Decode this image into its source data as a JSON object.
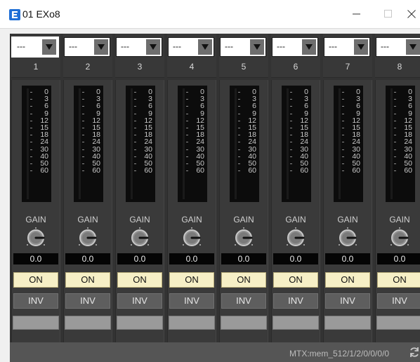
{
  "window": {
    "title": "01 EXo8",
    "minimize_glyph": "minimize-icon",
    "maximize_glyph": "maximize-icon",
    "close_glyph": "close-icon"
  },
  "channels": [
    {
      "select_value": "---",
      "number": "1",
      "gain_label": "GAIN",
      "gain_value": "0.0",
      "on_label": "ON",
      "inv_label": "INV"
    },
    {
      "select_value": "---",
      "number": "2",
      "gain_label": "GAIN",
      "gain_value": "0.0",
      "on_label": "ON",
      "inv_label": "INV"
    },
    {
      "select_value": "---",
      "number": "3",
      "gain_label": "GAIN",
      "gain_value": "0.0",
      "on_label": "ON",
      "inv_label": "INV"
    },
    {
      "select_value": "---",
      "number": "4",
      "gain_label": "GAIN",
      "gain_value": "0.0",
      "on_label": "ON",
      "inv_label": "INV"
    },
    {
      "select_value": "---",
      "number": "5",
      "gain_label": "GAIN",
      "gain_value": "0.0",
      "on_label": "ON",
      "inv_label": "INV"
    },
    {
      "select_value": "---",
      "number": "6",
      "gain_label": "GAIN",
      "gain_value": "0.0",
      "on_label": "ON",
      "inv_label": "INV"
    },
    {
      "select_value": "---",
      "number": "7",
      "gain_label": "GAIN",
      "gain_value": "0.0",
      "on_label": "ON",
      "inv_label": "INV"
    },
    {
      "select_value": "---",
      "number": "8",
      "gain_label": "GAIN",
      "gain_value": "0.0",
      "on_label": "ON",
      "inv_label": "INV"
    }
  ],
  "meter_scale": [
    "0",
    "3",
    "6",
    "9",
    "12",
    "15",
    "18",
    "24",
    "30",
    "40",
    "50",
    "60"
  ],
  "status": {
    "text": "MTX:mem_512/1/2/0/0/0/0"
  },
  "colors": {
    "accent": "#1f6fd6",
    "on_button": "#f6efc6",
    "panel": "#333333"
  }
}
